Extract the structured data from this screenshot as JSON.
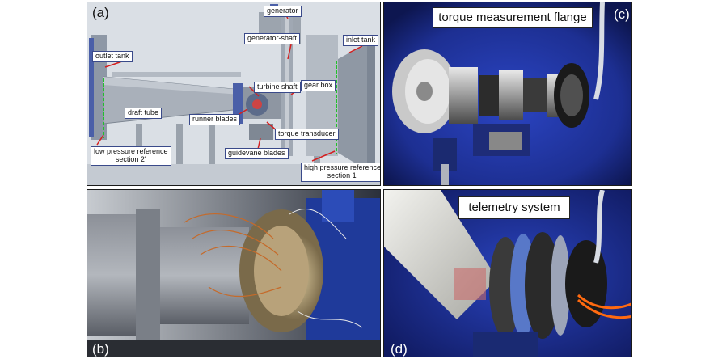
{
  "panel_a": {
    "letter": "(a)",
    "labels": {
      "generator": "generator",
      "generator_shaft": "generator-shaft",
      "inlet_tank": "inlet tank",
      "outlet_tank": "outlet tank",
      "turbine_shaft": "turbine shaft",
      "gear_box": "gear box",
      "draft_tube": "draft tube",
      "runner_blades": "runner blades",
      "torque_transducer": "torque transducer",
      "guidevane_blades": "guidevane blades",
      "low_pressure_ref": "low pressure reference",
      "section2": "section 2'",
      "high_pressure_ref": "high pressure reference",
      "section1": "section 1'"
    }
  },
  "panel_b": {
    "letter": "(b)"
  },
  "panel_c": {
    "letter": "(c)",
    "title": "torque measurement flange"
  },
  "panel_d": {
    "letter": "(d)",
    "title": "telemetry system"
  }
}
